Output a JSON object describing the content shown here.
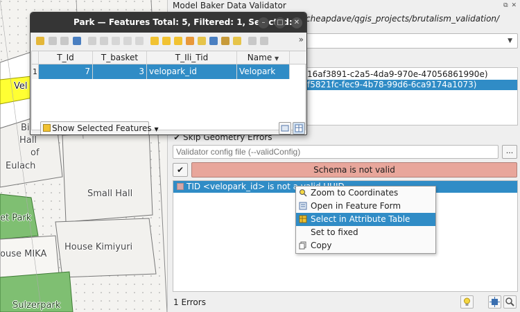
{
  "map": {
    "labels": {
      "vel": "Vel",
      "bi": "Bi",
      "hall": "Hall",
      "of": "of",
      "eulach": "Eulach",
      "small_hall": "Small Hall",
      "et_park": "et Park",
      "ouse_mika": "ouse MIKA",
      "house_kimiyuri": "House Kimiyuri",
      "sulzerpark": "Sulzerpark"
    }
  },
  "validator": {
    "title": "Model Baker Data Validator",
    "path_text": "/cheapdave/qgis_projects/brutalism_validation/",
    "tid_rows": [
      "16af3891-c2a5-4da9-970e-47056861990e)",
      "f5821fc-fec9-4b78-99d6-6ca9174a1073)"
    ],
    "skip_geometry_label": "Skip Geometry Errors",
    "config_placeholder": "Validator config file (--validConfig)",
    "browse_label": "...",
    "validate_icon": "✔",
    "status_text": "Schema is not valid",
    "status_color": "#e8a69b",
    "result_row": "TID <velopark_id> is not a valid UUID",
    "errors_count": "1 Errors"
  },
  "context_menu": {
    "items": [
      {
        "label": "Zoom to Coordinates",
        "icon": "zoom-icon"
      },
      {
        "label": "Open in Feature Form",
        "icon": "form-icon"
      },
      {
        "label": "Select in Attribute Table",
        "icon": "table-icon"
      },
      {
        "label": "Set to fixed",
        "icon": ""
      },
      {
        "label": "Copy",
        "icon": "copy-icon"
      }
    ]
  },
  "attribute_table": {
    "title": "Park — Features Total: 5, Filtered: 1, Selected: 1",
    "columns": [
      "T_Id",
      "T_basket",
      "T_Ili_Tid",
      "Name"
    ],
    "rows": [
      {
        "num": "1",
        "t_id": "7",
        "t_basket": "3",
        "t_ili_tid": "velopark_id",
        "name": "Velopark"
      }
    ],
    "filter_label": "Show Selected Features",
    "accent": "#308cc6"
  }
}
